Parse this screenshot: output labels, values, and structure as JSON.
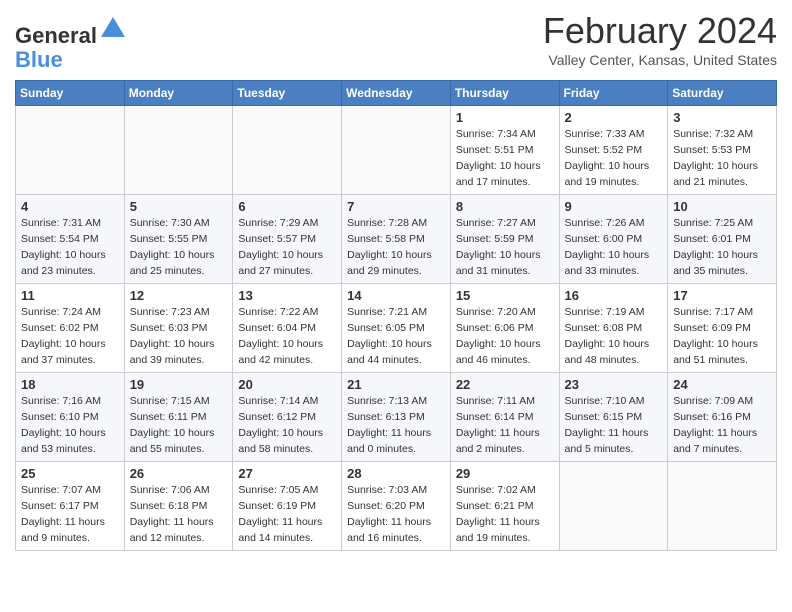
{
  "header": {
    "logo_line1": "General",
    "logo_line2": "Blue",
    "month": "February 2024",
    "location": "Valley Center, Kansas, United States"
  },
  "days_of_week": [
    "Sunday",
    "Monday",
    "Tuesday",
    "Wednesday",
    "Thursday",
    "Friday",
    "Saturday"
  ],
  "weeks": [
    [
      {
        "day": "",
        "info": ""
      },
      {
        "day": "",
        "info": ""
      },
      {
        "day": "",
        "info": ""
      },
      {
        "day": "",
        "info": ""
      },
      {
        "day": "1",
        "info": "Sunrise: 7:34 AM\nSunset: 5:51 PM\nDaylight: 10 hours\nand 17 minutes."
      },
      {
        "day": "2",
        "info": "Sunrise: 7:33 AM\nSunset: 5:52 PM\nDaylight: 10 hours\nand 19 minutes."
      },
      {
        "day": "3",
        "info": "Sunrise: 7:32 AM\nSunset: 5:53 PM\nDaylight: 10 hours\nand 21 minutes."
      }
    ],
    [
      {
        "day": "4",
        "info": "Sunrise: 7:31 AM\nSunset: 5:54 PM\nDaylight: 10 hours\nand 23 minutes."
      },
      {
        "day": "5",
        "info": "Sunrise: 7:30 AM\nSunset: 5:55 PM\nDaylight: 10 hours\nand 25 minutes."
      },
      {
        "day": "6",
        "info": "Sunrise: 7:29 AM\nSunset: 5:57 PM\nDaylight: 10 hours\nand 27 minutes."
      },
      {
        "day": "7",
        "info": "Sunrise: 7:28 AM\nSunset: 5:58 PM\nDaylight: 10 hours\nand 29 minutes."
      },
      {
        "day": "8",
        "info": "Sunrise: 7:27 AM\nSunset: 5:59 PM\nDaylight: 10 hours\nand 31 minutes."
      },
      {
        "day": "9",
        "info": "Sunrise: 7:26 AM\nSunset: 6:00 PM\nDaylight: 10 hours\nand 33 minutes."
      },
      {
        "day": "10",
        "info": "Sunrise: 7:25 AM\nSunset: 6:01 PM\nDaylight: 10 hours\nand 35 minutes."
      }
    ],
    [
      {
        "day": "11",
        "info": "Sunrise: 7:24 AM\nSunset: 6:02 PM\nDaylight: 10 hours\nand 37 minutes."
      },
      {
        "day": "12",
        "info": "Sunrise: 7:23 AM\nSunset: 6:03 PM\nDaylight: 10 hours\nand 39 minutes."
      },
      {
        "day": "13",
        "info": "Sunrise: 7:22 AM\nSunset: 6:04 PM\nDaylight: 10 hours\nand 42 minutes."
      },
      {
        "day": "14",
        "info": "Sunrise: 7:21 AM\nSunset: 6:05 PM\nDaylight: 10 hours\nand 44 minutes."
      },
      {
        "day": "15",
        "info": "Sunrise: 7:20 AM\nSunset: 6:06 PM\nDaylight: 10 hours\nand 46 minutes."
      },
      {
        "day": "16",
        "info": "Sunrise: 7:19 AM\nSunset: 6:08 PM\nDaylight: 10 hours\nand 48 minutes."
      },
      {
        "day": "17",
        "info": "Sunrise: 7:17 AM\nSunset: 6:09 PM\nDaylight: 10 hours\nand 51 minutes."
      }
    ],
    [
      {
        "day": "18",
        "info": "Sunrise: 7:16 AM\nSunset: 6:10 PM\nDaylight: 10 hours\nand 53 minutes."
      },
      {
        "day": "19",
        "info": "Sunrise: 7:15 AM\nSunset: 6:11 PM\nDaylight: 10 hours\nand 55 minutes."
      },
      {
        "day": "20",
        "info": "Sunrise: 7:14 AM\nSunset: 6:12 PM\nDaylight: 10 hours\nand 58 minutes."
      },
      {
        "day": "21",
        "info": "Sunrise: 7:13 AM\nSunset: 6:13 PM\nDaylight: 11 hours\nand 0 minutes."
      },
      {
        "day": "22",
        "info": "Sunrise: 7:11 AM\nSunset: 6:14 PM\nDaylight: 11 hours\nand 2 minutes."
      },
      {
        "day": "23",
        "info": "Sunrise: 7:10 AM\nSunset: 6:15 PM\nDaylight: 11 hours\nand 5 minutes."
      },
      {
        "day": "24",
        "info": "Sunrise: 7:09 AM\nSunset: 6:16 PM\nDaylight: 11 hours\nand 7 minutes."
      }
    ],
    [
      {
        "day": "25",
        "info": "Sunrise: 7:07 AM\nSunset: 6:17 PM\nDaylight: 11 hours\nand 9 minutes."
      },
      {
        "day": "26",
        "info": "Sunrise: 7:06 AM\nSunset: 6:18 PM\nDaylight: 11 hours\nand 12 minutes."
      },
      {
        "day": "27",
        "info": "Sunrise: 7:05 AM\nSunset: 6:19 PM\nDaylight: 11 hours\nand 14 minutes."
      },
      {
        "day": "28",
        "info": "Sunrise: 7:03 AM\nSunset: 6:20 PM\nDaylight: 11 hours\nand 16 minutes."
      },
      {
        "day": "29",
        "info": "Sunrise: 7:02 AM\nSunset: 6:21 PM\nDaylight: 11 hours\nand 19 minutes."
      },
      {
        "day": "",
        "info": ""
      },
      {
        "day": "",
        "info": ""
      }
    ]
  ]
}
